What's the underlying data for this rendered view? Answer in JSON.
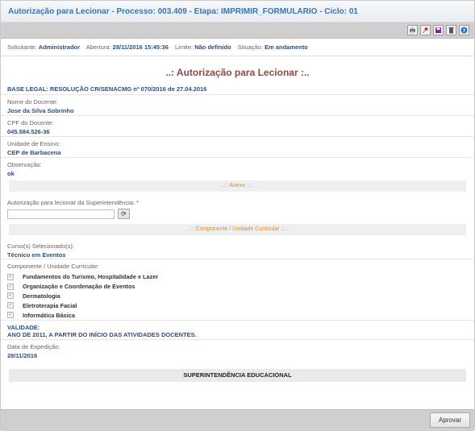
{
  "header": {
    "title": "Autorização para Lecionar - Processo: 003.409 - Etapa: IMPRIMIR_FORMULARIO - Ciclo: 01"
  },
  "toolbar": {
    "icons": [
      "printer-icon",
      "pin-icon",
      "save-icon",
      "trash-icon",
      "help-icon"
    ]
  },
  "info": {
    "solicitante_label": "Solicitante:",
    "solicitante": "Administrador",
    "abertura_label": "Abertura:",
    "abertura": "28/11/2016 15:45:36",
    "limite_label": "Limite:",
    "limite": "Não definido",
    "situacao_label": "Situação:",
    "situacao": "Em andamento"
  },
  "page_title": "..: Autorização para Lecionar :..",
  "base_legal": "BASE LEGAL: RESOLUÇÃO CR/SENACMG nº 070/2016 de 27.04.2016",
  "fields": {
    "docente_label": "Nome do Docente:",
    "docente": "Jose da Silva Sobrinho",
    "cpf_label": "CPF do Docente:",
    "cpf": "045.584.526-36",
    "unidade_label": "Unidade de Ensino:",
    "unidade": "CEP de Barbacena",
    "obs_label": "Observação:",
    "obs": "ok"
  },
  "anexo": {
    "section": "..:: Anexo ::..",
    "label": "Autorização para lecionar da Superintendência: *"
  },
  "componente": {
    "section": "..:: Componente / Unidade Curricular ::..",
    "cursos_label": "Curso(s) Selecionado(s):",
    "cursos": "Técnico em Eventos",
    "lista_label": "Componente / Unidade Curricular:",
    "items": [
      "Fundamentos do Turismo, Hospitalidade e Lazer",
      "Organização e Coordenação de Eventos",
      "Dermatologia",
      "Eletroterapia Facial",
      "Informática Básica"
    ]
  },
  "validade": {
    "title": "VALIDADE:",
    "text": "ANO DE 2011, A PARTIR DO INÍCIO DAS ATIVIDADES DOCENTES."
  },
  "expedicao": {
    "label": "Data de Expedição:",
    "value": "28/11/2016"
  },
  "superintendencia": "SUPERINTENDÊNCIA EDUCACIONAL",
  "footer": {
    "approve_label": "Aprovar"
  }
}
